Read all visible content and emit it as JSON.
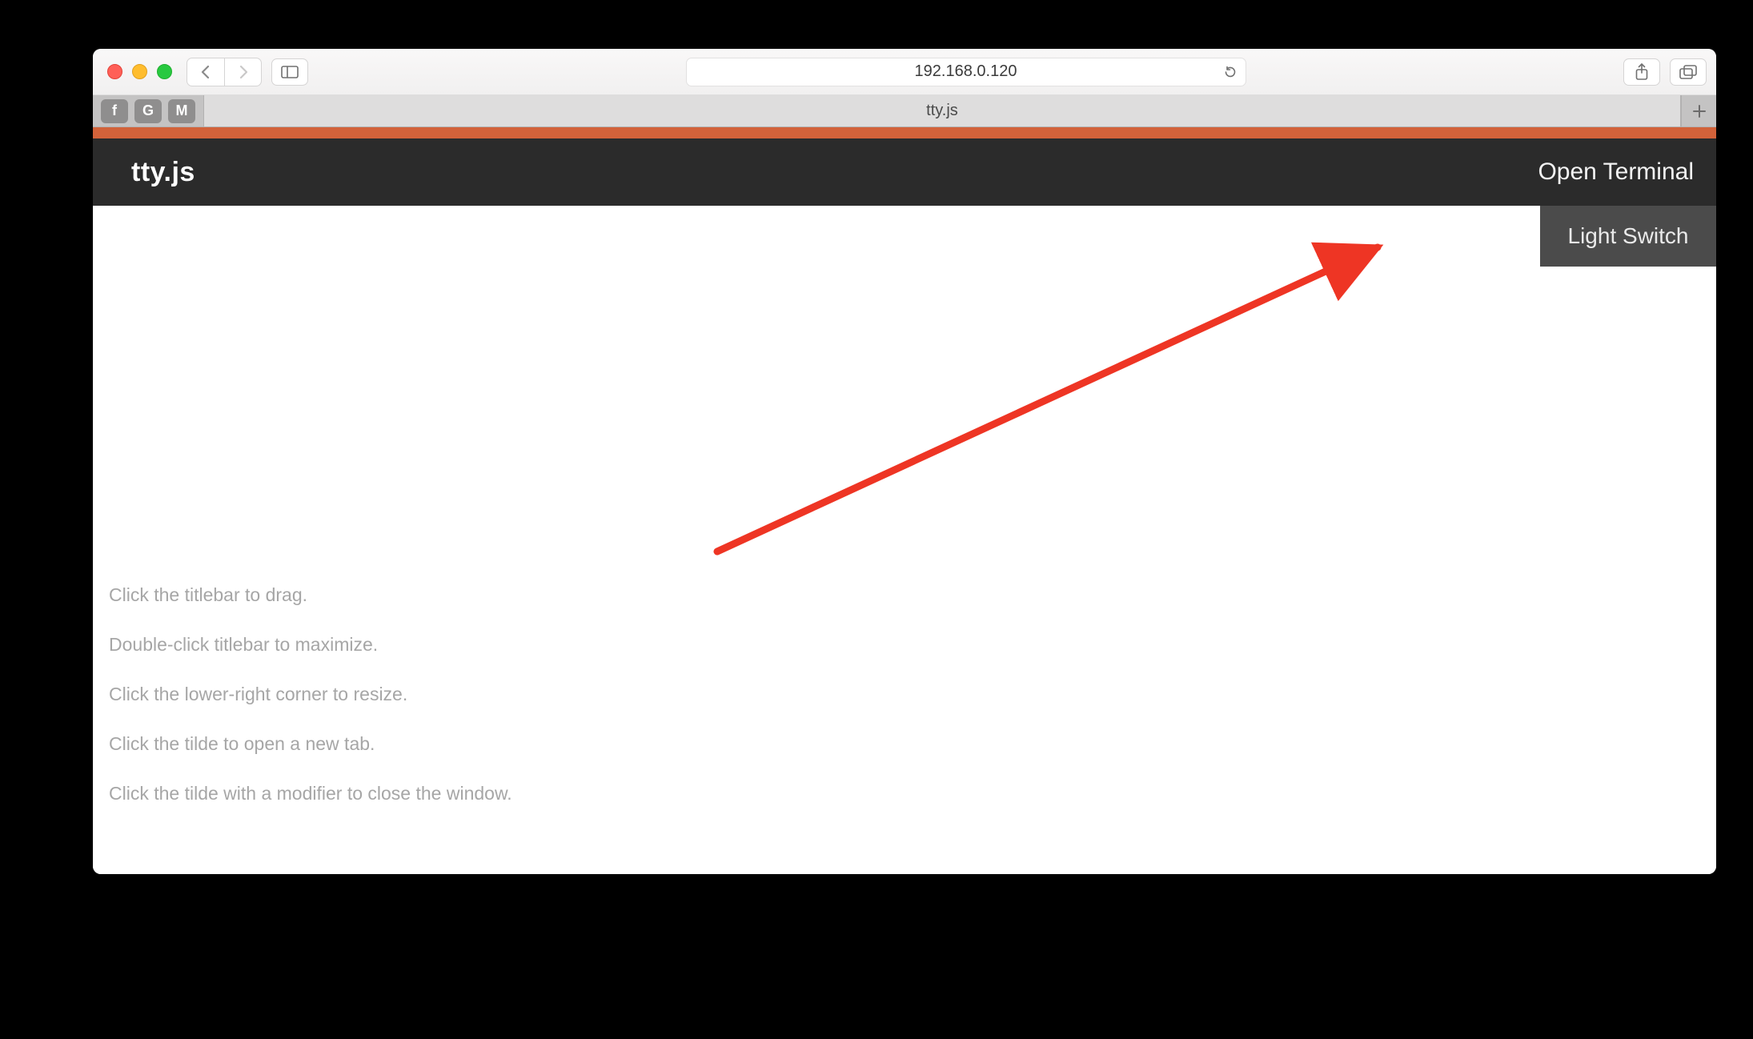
{
  "browser": {
    "address": "192.168.0.120",
    "tab_title": "tty.js",
    "bookmarks": [
      "f",
      "G",
      "M"
    ],
    "icons": {
      "back": "back-icon",
      "forward": "forward-icon",
      "sidebar": "sidebar-toggle-icon",
      "reload": "reload-icon",
      "share": "share-icon",
      "tabs": "tabs-overview-icon",
      "newtab": "plus-icon"
    }
  },
  "app": {
    "brand": "tty.js",
    "open_terminal": "Open Terminal",
    "dropdown_item": "Light Switch",
    "help": [
      "Click the titlebar to drag.",
      "Double-click titlebar to maximize.",
      "Click the lower-right corner to resize.",
      "Click the tilde to open a new tab.",
      "Click the tilde with a modifier to close the window."
    ]
  },
  "annotation": {
    "kind": "arrow",
    "color": "#ee3524",
    "from_note": "pointing from page center toward Open Terminal"
  }
}
